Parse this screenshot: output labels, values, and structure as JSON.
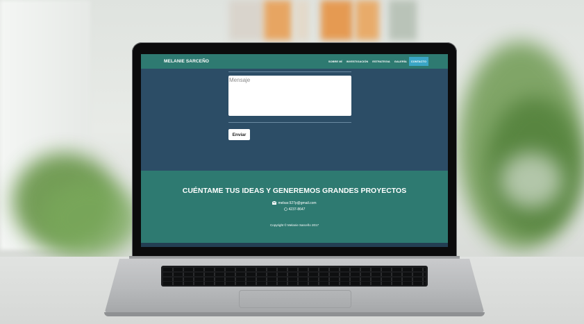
{
  "site": {
    "brand": "MELANIE SARCEÑO",
    "nav": [
      {
        "label": "SOBRE MÍ",
        "active": false
      },
      {
        "label": "INVESTIGACIÓN",
        "active": false
      },
      {
        "label": "ESTRATEGIA",
        "active": false
      },
      {
        "label": "GALERÍA",
        "active": false
      },
      {
        "label": "CONTACTO",
        "active": true
      }
    ],
    "form": {
      "message_placeholder": "Mensaje",
      "send_label": "Enviar"
    },
    "footer": {
      "title": "CUÉNTAME TUS IDEAS Y GENEREMOS GRANDES PROYECTOS",
      "email": "melsar.927p@gmail.com",
      "phone": "4237-8647",
      "copyright": "Copyright © Melanie Sarceño 2017"
    }
  },
  "icons": {
    "email": "envelope-icon",
    "phone": "whatsapp-icon"
  },
  "colors": {
    "navbar": "#2e7a71",
    "content_bg": "#2c4d66",
    "active_nav": "#3aa6c6",
    "footer": "#2e7a71"
  }
}
